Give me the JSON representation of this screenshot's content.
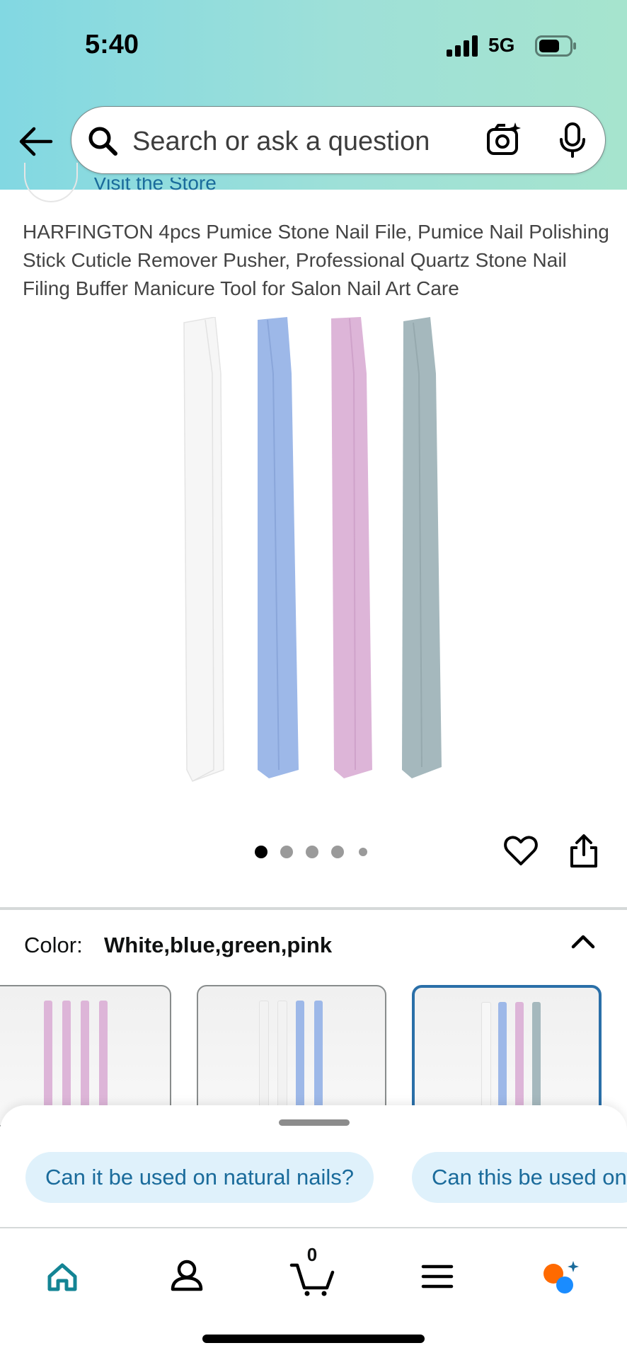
{
  "status_bar": {
    "time": "5:40",
    "network": "5G"
  },
  "search": {
    "placeholder": "Search or ask a question"
  },
  "store": {
    "link_text": "Visit the Store"
  },
  "product": {
    "title": "HARFINGTON 4pcs Pumice Stone Nail File, Pumice Nail Polishing Stick Cuticle Remover Pusher, Professional Quartz Stone Nail Filing Buffer Manicure Tool for Salon Nail Art Care",
    "image_stick_colors": [
      "#f7f7f7",
      "#9db8e8",
      "#ddb5d8",
      "#a5b8bd"
    ],
    "image_count": 5,
    "active_image_index": 0
  },
  "variation": {
    "label": "Color:",
    "value": "White,blue,green,pink",
    "swatches": [
      {
        "colors": [
          "#ddb5d8",
          "#ddb5d8",
          "#ddb5d8",
          "#ddb5d8"
        ],
        "selected": false
      },
      {
        "colors": [
          "#f2f2f2",
          "#f2f2f2",
          "#9db8e8",
          "#9db8e8"
        ],
        "selected": false
      },
      {
        "colors": [
          "#f7f7f7",
          "#9db8e8",
          "#ddb5d8",
          "#a5b8bd"
        ],
        "selected": true
      }
    ]
  },
  "suggestions": [
    {
      "text": "Can it be used on natural nails?"
    },
    {
      "text": "Can this be used on"
    }
  ],
  "nav": {
    "cart_count": "0",
    "items": [
      "home-icon",
      "account-icon",
      "cart-icon",
      "menu-icon",
      "rufus-icon"
    ]
  },
  "colors": {
    "accent": "#1a6b9b",
    "selected_border": "#2a6fa8",
    "chip_bg": "#dff1fb",
    "home_active": "#138494"
  }
}
